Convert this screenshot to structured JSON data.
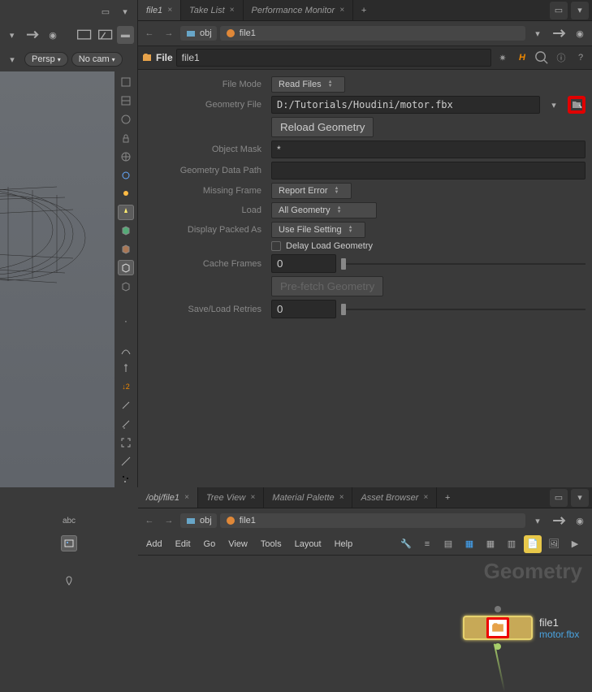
{
  "viewport": {
    "persp_label": "Persp",
    "nocam_label": "No cam",
    "toolbar_icons": [
      "drop",
      "pin",
      "orbit",
      "shelf1",
      "shelf2",
      "rect"
    ],
    "right_rail_icons": [
      "display-all",
      "display-templated",
      "ghost",
      "lock",
      "globe",
      "freeze",
      "sun",
      "cube-a",
      "cube-b",
      "bulb",
      "cube-c",
      "cube-wire",
      "ctrl",
      "struct",
      "snap1",
      "snap2",
      "snap3",
      "snap4",
      "snap5",
      "snap6"
    ]
  },
  "params": {
    "tabs": [
      {
        "label": "file1",
        "active": true
      },
      {
        "label": "Take List",
        "active": false
      },
      {
        "label": "Performance Monitor",
        "active": false
      }
    ],
    "path": {
      "seg1": "obj",
      "seg2": "file1"
    },
    "node_type": "File",
    "node_name": "file1",
    "header_icons": [
      "gear",
      "h-help",
      "search",
      "info",
      "help"
    ],
    "fields": {
      "file_mode_label": "File Mode",
      "file_mode_value": "Read Files",
      "geo_file_label": "Geometry File",
      "geo_file_value": "D:/Tutorials/Houdini/motor.fbx",
      "reload_label": "Reload Geometry",
      "obj_mask_label": "Object Mask",
      "obj_mask_value": "*",
      "data_path_label": "Geometry Data Path",
      "data_path_value": "",
      "missing_label": "Missing Frame",
      "missing_value": "Report Error",
      "load_label": "Load",
      "load_value": "All Geometry",
      "packed_label": "Display Packed As",
      "packed_value": "Use File Setting",
      "delay_label": "Delay Load Geometry",
      "cache_label": "Cache Frames",
      "cache_value": "0",
      "prefetch_label": "Pre-fetch Geometry",
      "retries_label": "Save/Load Retries",
      "retries_value": "0"
    }
  },
  "network": {
    "tabs": [
      {
        "label": "/obj/file1",
        "active": true
      },
      {
        "label": "Tree View",
        "active": false
      },
      {
        "label": "Material Palette",
        "active": false
      },
      {
        "label": "Asset Browser",
        "active": false
      }
    ],
    "path": {
      "seg1": "obj",
      "seg2": "file1"
    },
    "menu": [
      "Add",
      "Edit",
      "Go",
      "View",
      "Tools",
      "Layout",
      "Help"
    ],
    "watermark": "Geometry",
    "node": {
      "name": "file1",
      "file": "motor.fbx"
    }
  },
  "left_bottom": {
    "abc": "abc"
  }
}
